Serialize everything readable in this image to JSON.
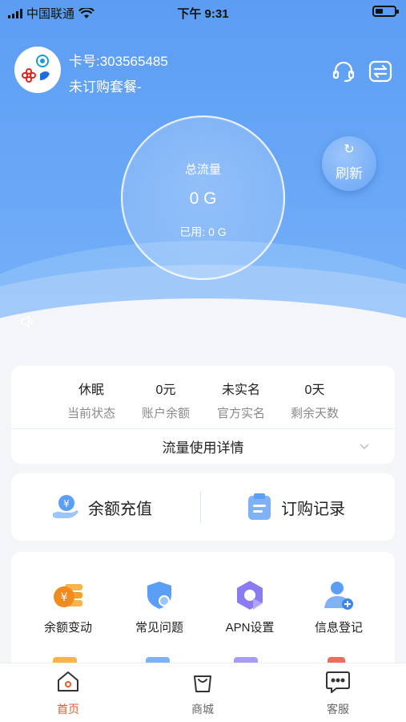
{
  "status_bar": {
    "carrier": "中国联通",
    "time": "下午 9:31"
  },
  "account": {
    "card_number": "卡号:303565485",
    "plan_status": "未订购套餐-"
  },
  "usage": {
    "title": "总流量",
    "total": "0 G",
    "used": "已用: 0 G"
  },
  "refresh_label": "刷新",
  "stats": [
    {
      "value": "休眠",
      "label": "当前状态"
    },
    {
      "value": "0元",
      "label": "账户余额"
    },
    {
      "value": "未实名",
      "label": "官方实名"
    },
    {
      "value": "0天",
      "label": "剩余天数"
    }
  ],
  "usage_detail_label": "流量使用详情",
  "actions": {
    "recharge": "余额充值",
    "orders": "订购记录"
  },
  "grid": [
    {
      "label": "余额变动",
      "icon": "coins-icon"
    },
    {
      "label": "常见问题",
      "icon": "shield-search-icon"
    },
    {
      "label": "APN设置",
      "icon": "hexagon-settings-icon"
    },
    {
      "label": "信息登记",
      "icon": "user-add-icon"
    }
  ],
  "tabs": [
    {
      "label": "首页",
      "icon": "home-icon",
      "active": true
    },
    {
      "label": "商城",
      "icon": "shopping-bag-icon",
      "active": false
    },
    {
      "label": "客服",
      "icon": "chat-icon",
      "active": false
    }
  ],
  "colors": {
    "primary": "#5c9df3",
    "accent": "#e35a2c",
    "text": "#222222",
    "muted": "#8a8a8a"
  }
}
